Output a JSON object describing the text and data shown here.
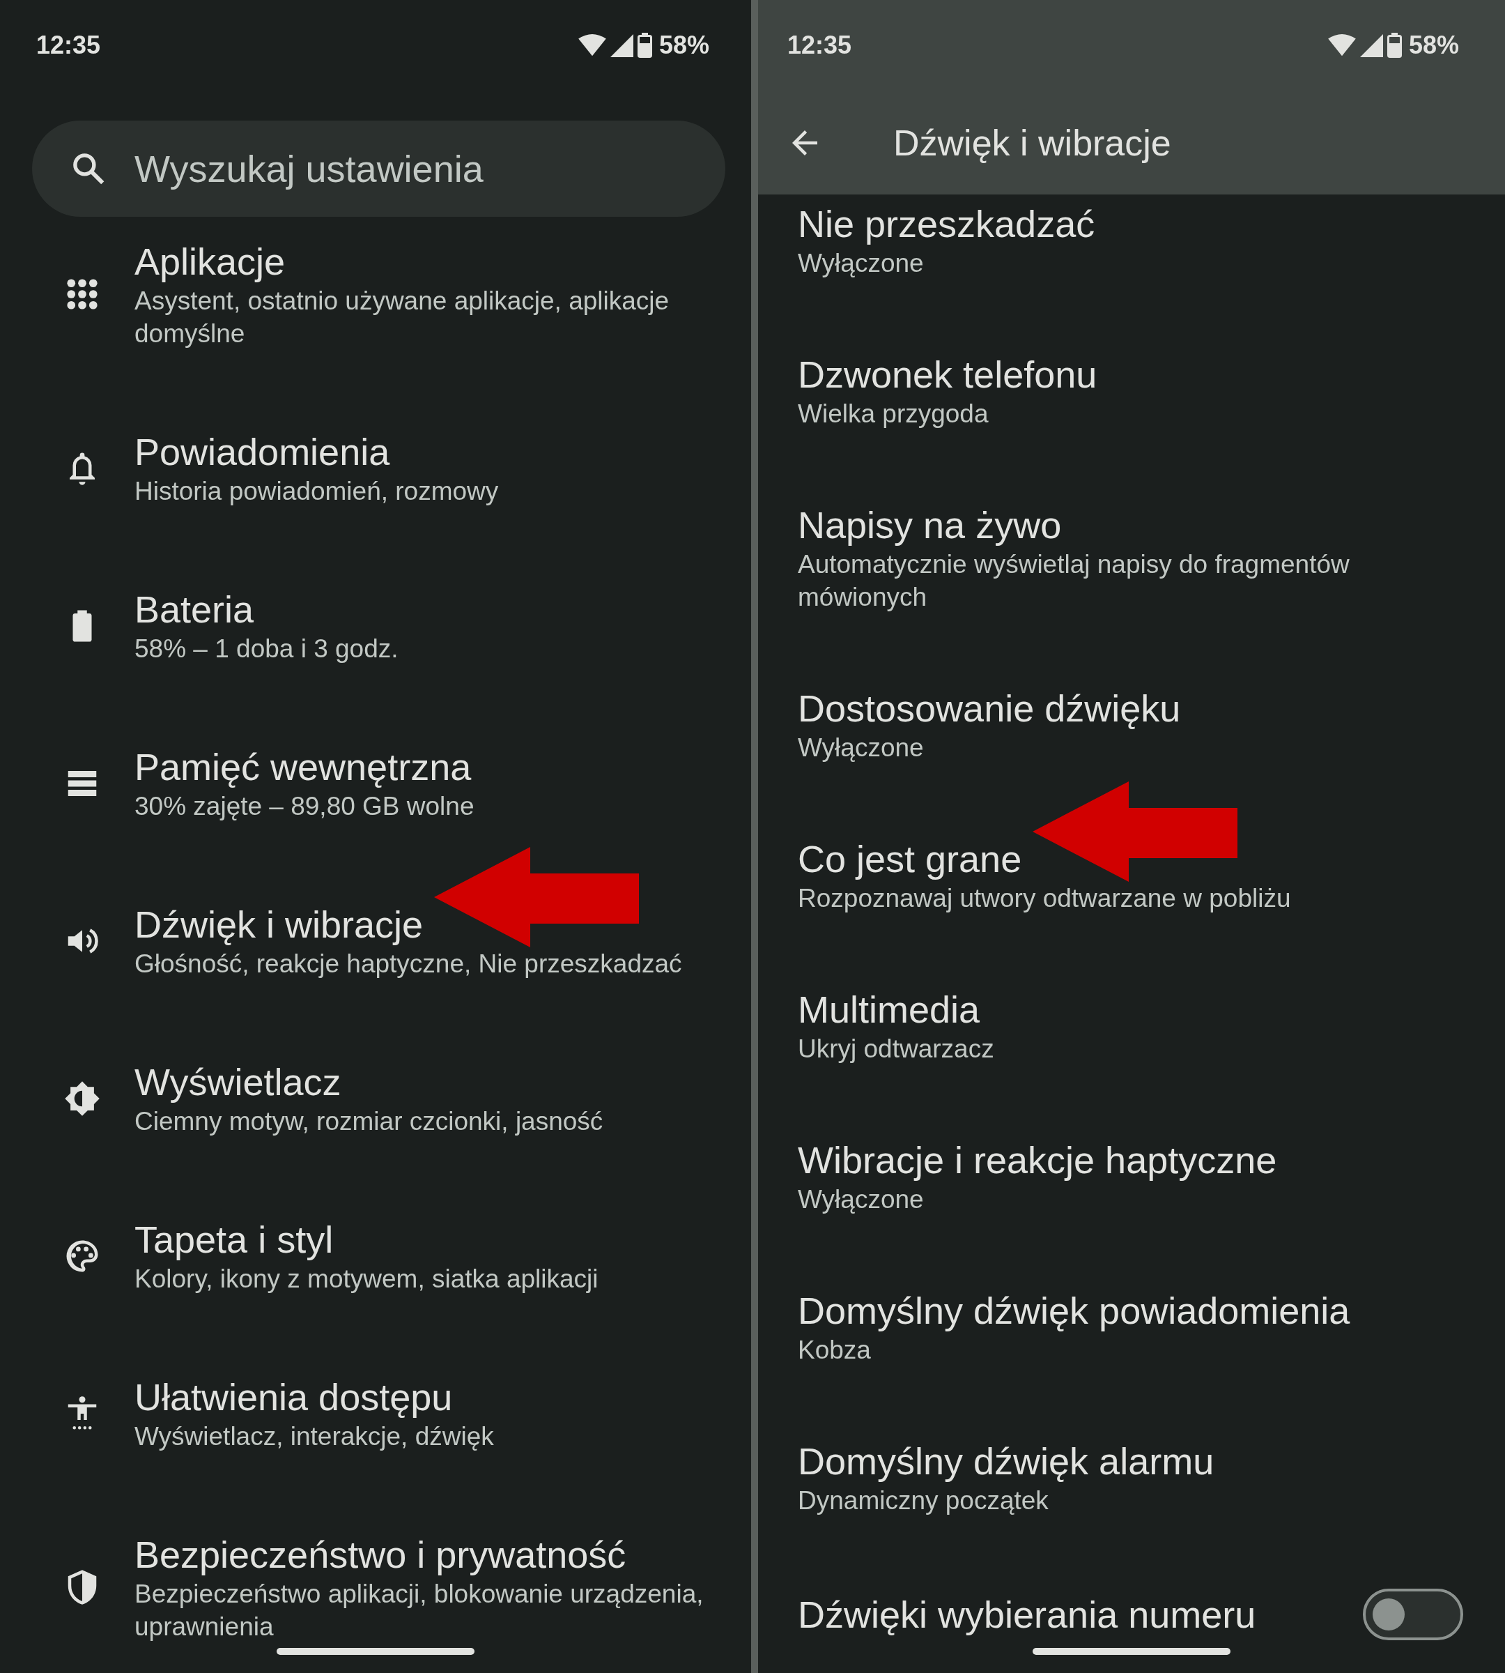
{
  "left_screen": {
    "status_bar": {
      "time": "12:35",
      "battery": "58%"
    },
    "search": {
      "placeholder": "Wyszukaj ustawienia"
    },
    "items": [
      {
        "title": "Aplikacje",
        "subtitle": "Asystent, ostatnio używane aplikacje, aplikacje domyślne"
      },
      {
        "title": "Powiadomienia",
        "subtitle": "Historia powiadomień, rozmowy"
      },
      {
        "title": "Bateria",
        "subtitle": "58% – 1 doba i 3 godz."
      },
      {
        "title": "Pamięć wewnętrzna",
        "subtitle": "30% zajęte – 89,80 GB wolne"
      },
      {
        "title": "Dźwięk i wibracje",
        "subtitle": "Głośność, reakcje haptyczne, Nie przeszkadzać",
        "arrow": true
      },
      {
        "title": "Wyświetlacz",
        "subtitle": "Ciemny motyw, rozmiar czcionki, jasność"
      },
      {
        "title": "Tapeta i styl",
        "subtitle": "Kolory, ikony z motywem, siatka aplikacji"
      },
      {
        "title": "Ułatwienia dostępu",
        "subtitle": "Wyświetlacz, interakcje, dźwięk"
      },
      {
        "title": "Bezpieczeństwo i prywatność",
        "subtitle": "Bezpieczeństwo aplikacji, blokowanie urządzenia, uprawnienia"
      }
    ]
  },
  "right_screen": {
    "status_bar": {
      "time": "12:35",
      "battery": "58%"
    },
    "toolbar": {
      "title": "Dźwięk i wibracje"
    },
    "items": [
      {
        "kind": "text",
        "title": "Nie przeszkadzać",
        "subtitle": "Wyłączone"
      },
      {
        "kind": "text",
        "title": "Dzwonek telefonu",
        "subtitle": "Wielka przygoda"
      },
      {
        "kind": "text",
        "title": "Napisy na żywo",
        "subtitle": "Automatycznie wyświetlaj napisy do fragmentów mówionych"
      },
      {
        "kind": "text",
        "title": "Dostosowanie dźwięku",
        "subtitle": "Wyłączone"
      },
      {
        "kind": "text",
        "title": "Co jest grane",
        "subtitle": "Rozpoznawaj utwory odtwarzane w pobliżu",
        "arrow": true
      },
      {
        "kind": "text",
        "title": "Multimedia",
        "subtitle": "Ukryj odtwarzacz"
      },
      {
        "kind": "text",
        "title": "Wibracje i reakcje haptyczne",
        "subtitle": "Wyłączone"
      },
      {
        "kind": "text",
        "title": "Domyślny dźwięk powiadomienia",
        "subtitle": "Kobza"
      },
      {
        "kind": "text",
        "title": "Domyślny dźwięk alarmu",
        "subtitle": "Dynamiczny początek"
      },
      {
        "kind": "toggle",
        "title": "Dźwięki wybierania numeru",
        "on": false
      }
    ]
  }
}
